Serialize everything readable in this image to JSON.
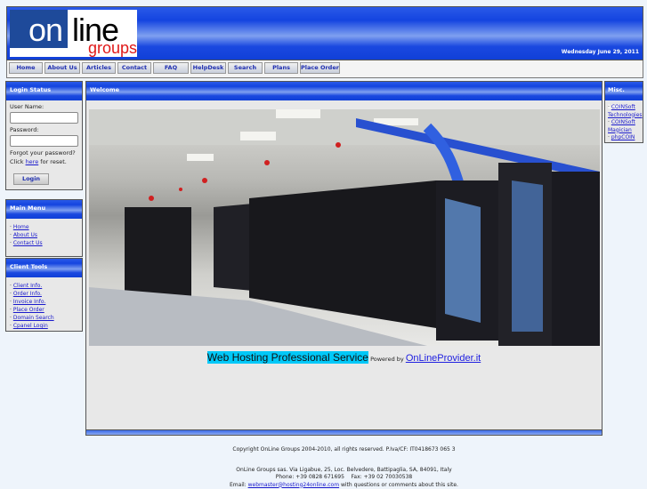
{
  "header": {
    "logo_on": "on",
    "logo_line": "line",
    "logo_groups": "groups",
    "date": "Wednesday June 29, 2011"
  },
  "nav": [
    "Home",
    "About Us",
    "Articles",
    "Contact",
    "FAQ",
    "HelpDesk",
    "Search",
    "Plans",
    "Place Order"
  ],
  "login": {
    "title": "Login Status",
    "user_label": "User Name:",
    "pass_label": "Password:",
    "forgot": "Forgot your password?",
    "click": "Click ",
    "here": "here",
    "for_reset": " for reset.",
    "button": "Login"
  },
  "main_menu": {
    "title": "Main Menu",
    "items": [
      "Home",
      "About Us",
      "Contact Us"
    ]
  },
  "client_tools": {
    "title": "Client Tools",
    "items": [
      "Client Info.",
      "Order Info.",
      "Invoice Info.",
      "Place Order",
      "Domain Search",
      "Cpanel Login"
    ]
  },
  "welcome": {
    "title": "Welcome",
    "headline": "Web Hosting Professional Service",
    "powered": "Powered by",
    "provider": "OnLineProvider.it"
  },
  "misc": {
    "title": "Misc. Links",
    "items": [
      "COINSoft Technologies",
      "COINSoft Magician",
      "phpCOIN"
    ]
  },
  "footer": {
    "copyright": "Copyright OnLine Groups 2004-2010, all rights reserved. P.Iva/CF: IT0418673 065 3",
    "address": "OnLine Groups sas. Via Ligabue, 25, Loc. Belvedere, Battipaglia, SA, 84091, Italy",
    "phone": "Phone: +39 0828 671695    Fax: +39 02 70030538",
    "email_prefix": "Email: ",
    "email": "webmaster@hosting24online.com",
    "email_suffix": " with questions or comments about this site."
  }
}
